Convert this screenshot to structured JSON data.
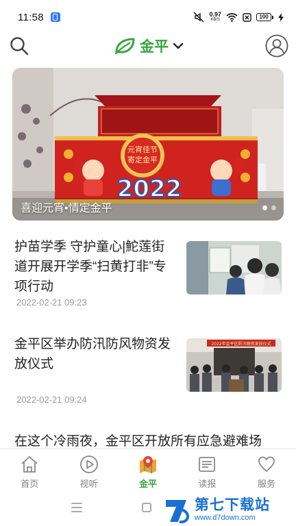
{
  "status_bar": {
    "time": "11:58",
    "net_speed_value": "0.97",
    "net_speed_unit": "KB/S",
    "battery_level": "100"
  },
  "header": {
    "title": "金平",
    "brand_color": "#3aa53f"
  },
  "banner": {
    "caption": "喜迎元宵•情定金平",
    "sign_line1": "元宵佳节",
    "sign_line2": "寄定金平",
    "year_text": "2022",
    "slide_count": 2,
    "active_slide": 1
  },
  "news": [
    {
      "title": "护苗学季 守护童心|鮀莲街道开展开学季“扫黄打非”专项行动",
      "date": "2022-02-21 09:23"
    },
    {
      "title": "金平区举办防汛防风物资发放仪式",
      "date": "2022-02-21 09:24",
      "thumb_banner_text": "2022年金平区防汛物资发放仪式"
    },
    {
      "title": "在这个冷雨夜，金平区开放所有应急避难场",
      "date": ""
    }
  ],
  "bottom_nav": [
    {
      "label": "首页",
      "icon": "home-icon",
      "active": false
    },
    {
      "label": "视听",
      "icon": "play-icon",
      "active": false
    },
    {
      "label": "金平",
      "icon": "map-pin-icon",
      "active": true
    },
    {
      "label": "读报",
      "icon": "newspaper-icon",
      "active": false
    },
    {
      "label": "服务",
      "icon": "heart-icon",
      "active": false
    }
  ],
  "watermark": {
    "title": "第七下载站",
    "url": "www.d7down.com"
  }
}
